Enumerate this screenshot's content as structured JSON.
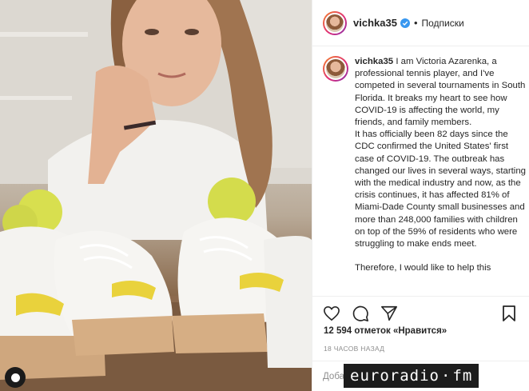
{
  "post": {
    "username": "vichka35",
    "follow_label": "Подписки",
    "separator": "•"
  },
  "caption": {
    "username": "vichka35",
    "paragraph1": "I am Victoria Azarenka, a professional tennis player, and I've competed in several tournaments in South Florida. It breaks my heart to see how COVID-19 is affecting the world, my friends, and family members.",
    "paragraph2": "It has officially been 82 days since the CDC confirmed the United States' first case of COVID-19. The outbreak has changed our lives in several ways, starting with the medical industry and now, as the crisis continues, it has affected 81% of Miami-Dade County small businesses and more than 248,000 families with children on top of the 59% of residents who were struggling to make ends meet.",
    "paragraph3": "Therefore, I would like to help this"
  },
  "stats": {
    "likes": "12 594 отметок «Нравится»",
    "time": "18 ЧАСОВ НАЗАД"
  },
  "comment": {
    "placeholder": "Добавьте комментарий..."
  },
  "watermark": {
    "part1": "euroradio",
    "sep": "·",
    "part2": "fm"
  },
  "icons": {
    "like": "heart-icon",
    "comment": "comment-icon",
    "share": "share-icon",
    "save": "bookmark-icon",
    "verified": "verified-badge-icon"
  },
  "colors": {
    "verified": "#3897f0",
    "text": "#262626",
    "muted": "#8e8e8e",
    "border": "#efefef"
  }
}
